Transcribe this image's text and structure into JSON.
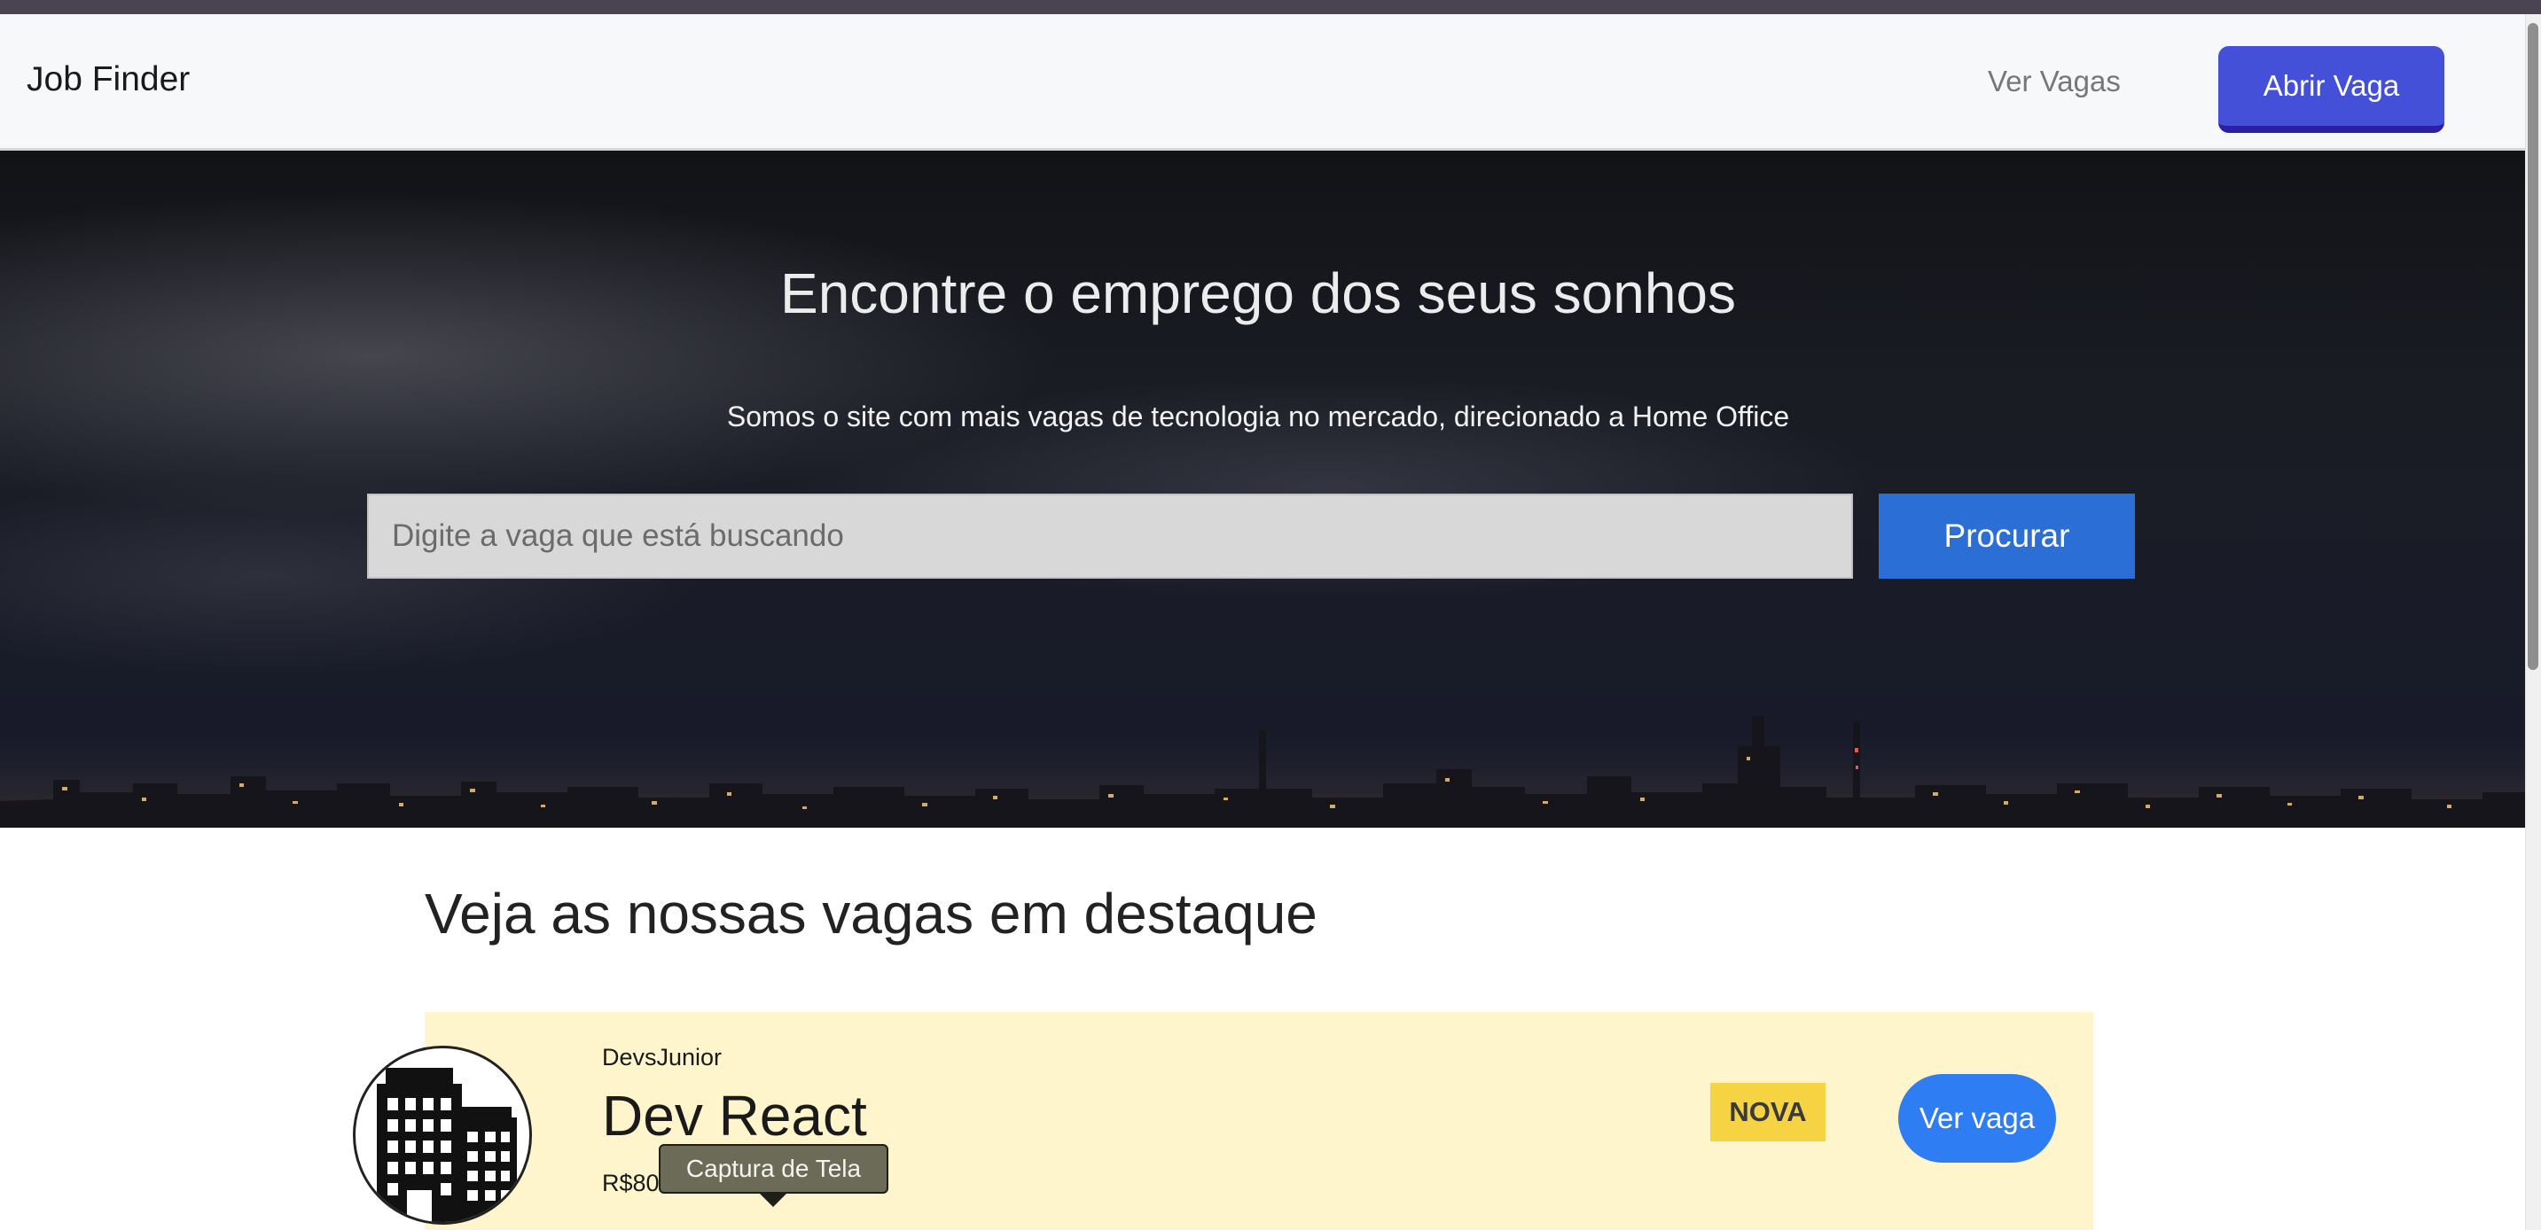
{
  "navbar": {
    "brand": "Job Finder",
    "link_label": "Ver Vagas",
    "cta_label": "Abrir Vaga"
  },
  "hero": {
    "title": "Encontre o emprego dos seus sonhos",
    "subtitle": "Somos o site com mais vagas de tecnologia no mercado, direcionado a Home Office",
    "search_placeholder": "Digite a vaga que está buscando",
    "search_button": "Procurar"
  },
  "featured": {
    "title": "Veja as nossas vagas em destaque",
    "jobs": [
      {
        "company": "DevsJunior",
        "title": "Dev React",
        "salary": "R$80",
        "badge": "NOVA",
        "button": "Ver vaga",
        "logo_icon": "building-icon"
      }
    ]
  },
  "tooltip": {
    "label": "Captura de Tela"
  },
  "colors": {
    "accent": "#4450d8",
    "search_button": "#2b6fd6",
    "card_background": "#fff5cc",
    "badge": "#f6d343",
    "job_button": "#2f7df2"
  }
}
